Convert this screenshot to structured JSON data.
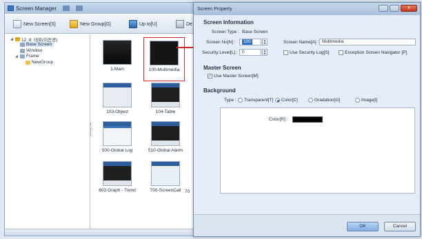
{
  "manager": {
    "title": "Screen Manager",
    "toolbar": {
      "new_screen": "New Screen[S]",
      "new_group": "New Group[G]",
      "up_to": "Up to[U]",
      "delete": "De"
    },
    "tree": {
      "project": "12_8_데모(이전경)",
      "base_screen": "Base Screen",
      "window": "Window",
      "frame": "Frame",
      "new_group": "NewGroup"
    },
    "thumbnails": [
      {
        "label": "1-Main"
      },
      {
        "label": "100-Multimedia"
      },
      {
        "label": "103-Object"
      },
      {
        "label": "104-Table"
      },
      {
        "label": "500-Global Log"
      },
      {
        "label": "510-Global Alarm"
      },
      {
        "label": "602-Graph - Trend"
      },
      {
        "label": "700-ScreenCall"
      },
      {
        "label": "70"
      }
    ]
  },
  "dialog": {
    "title": "Screen Property",
    "close_label": "x",
    "screen_info": {
      "heading": "Screen Information",
      "screen_type_label": "Screen Type :",
      "screen_type_value": "Base Screen",
      "screen_no_label": "Screen No[N] :",
      "screen_no_value": "100",
      "screen_name_label": "Screen Name[A] :",
      "screen_name_value": "Multimedia",
      "security_level_label": "Security Level[L] :",
      "security_level_value": "0",
      "use_security_log": "Use Security Log[S]",
      "exception_navigator": "Exception Screen Navigator [P]"
    },
    "master": {
      "heading": "Master Screen",
      "use_master": "Use Master Screen[M]"
    },
    "background": {
      "heading": "Background",
      "type_label": "Type :",
      "options": [
        "Transparent[T]",
        "Color[C]",
        "Gradation[G]",
        "Image[I]"
      ],
      "selected": "Color[C]",
      "color_label": "Color[R] :",
      "color_value": "#000000"
    },
    "buttons": {
      "ok": "OK",
      "cancel": "Cancel"
    }
  }
}
